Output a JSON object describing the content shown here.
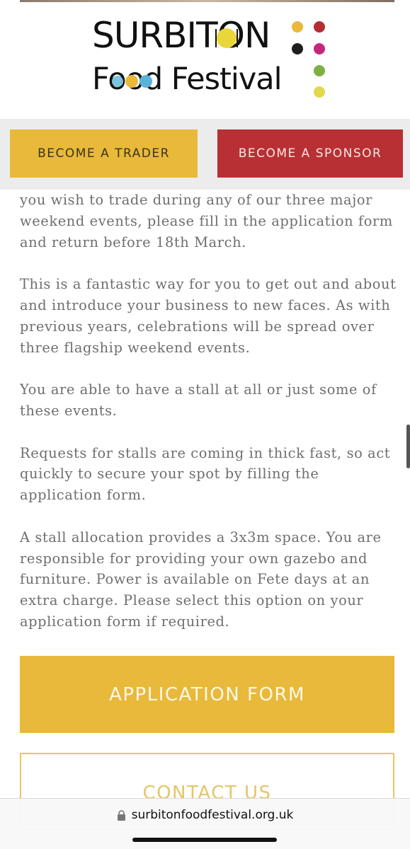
{
  "header": {
    "logo_line1": "SURBITON",
    "logo_line2": "Food Festival",
    "dot_colors": [
      "#e9b93c",
      "#b42e33",
      "#1e1e1e",
      "#c4287b",
      "#7cb043",
      "#e1d84b"
    ]
  },
  "nav": {
    "trader_label": "BECOME A TRADER",
    "sponsor_label": "BECOME A SPONSOR"
  },
  "content": {
    "paragraphs": [
      "you wish to trade during any of our three major weekend events, please fill in the application form and return before 18th March.",
      "This is a fantastic way for you to get out and about and introduce your business to new faces. As with previous years, celebrations will be spread over three flagship weekend events.",
      "You are able to have a stall at all or just some of these events.",
      "Requests for stalls are coming in thick fast, so act quickly to secure your spot by filling the application form.",
      "A stall allocation provides a 3x3m space. You are responsible for providing your own gazebo and furniture. Power is available on Fete days at an extra charge. Please select this option on your application form if required."
    ]
  },
  "buttons": {
    "application_label": "APPLICATION FORM",
    "contact_label": "CONTACT US"
  },
  "browser": {
    "url": "surbitonfoodfestival.org.uk"
  },
  "colors": {
    "gold": "#e8b93a",
    "red": "#b83034",
    "body_text": "#6e6e6e"
  }
}
